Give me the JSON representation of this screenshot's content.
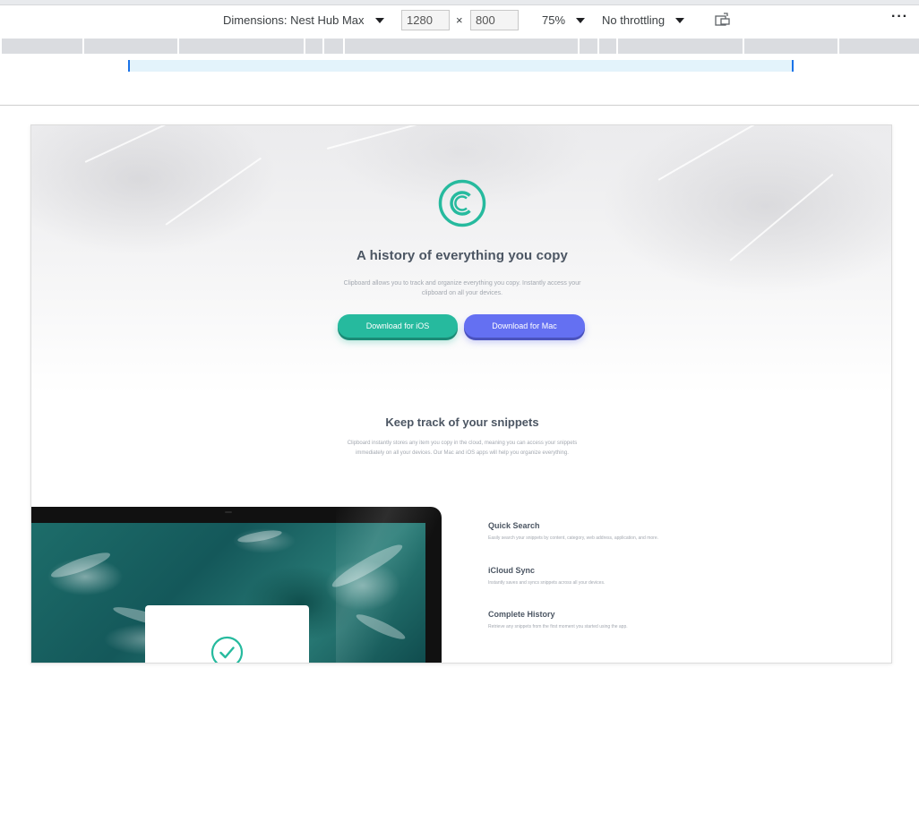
{
  "devtools": {
    "dimensions_label": "Dimensions: Nest Hub Max",
    "width_value": "1280",
    "height_value": "800",
    "times_sign": "×",
    "zoom_label": "75%",
    "throttling_label": "No throttling",
    "rotate_icon": "rotate-device-icon",
    "more_icon": "more-options-icon",
    "more_glyph": "···"
  },
  "page": {
    "hero": {
      "logo_icon": "clipboard-logo-icon",
      "title": "A history of everything you copy",
      "text": "Clipboard allows you to track and organize everything you copy. Instantly access your clipboard on all your devices.",
      "ios_button": "Download for iOS",
      "mac_button": "Download for Mac"
    },
    "snippets": {
      "title": "Keep track of your snippets",
      "text": "Clipboard instantly stores any item you copy in the cloud, meaning you can access your snippets immediately on all your devices. Our Mac and iOS apps will help you organize everything."
    },
    "features": [
      {
        "title": "Quick Search",
        "text": "Easily search your snippets by content, category, web address, application, and more."
      },
      {
        "title": "iCloud Sync",
        "text": "Instantly saves and syncs snippets across all your devices."
      },
      {
        "title": "Complete History",
        "text": "Retrieve any snippets from the first moment you started using the app."
      }
    ],
    "check_icon": "checkmark-circle-icon"
  },
  "colors": {
    "accent_green": "#26ba9e",
    "accent_blue": "#6470f2",
    "heading": "#4c5663",
    "muted_text": "#a3a8b0"
  }
}
